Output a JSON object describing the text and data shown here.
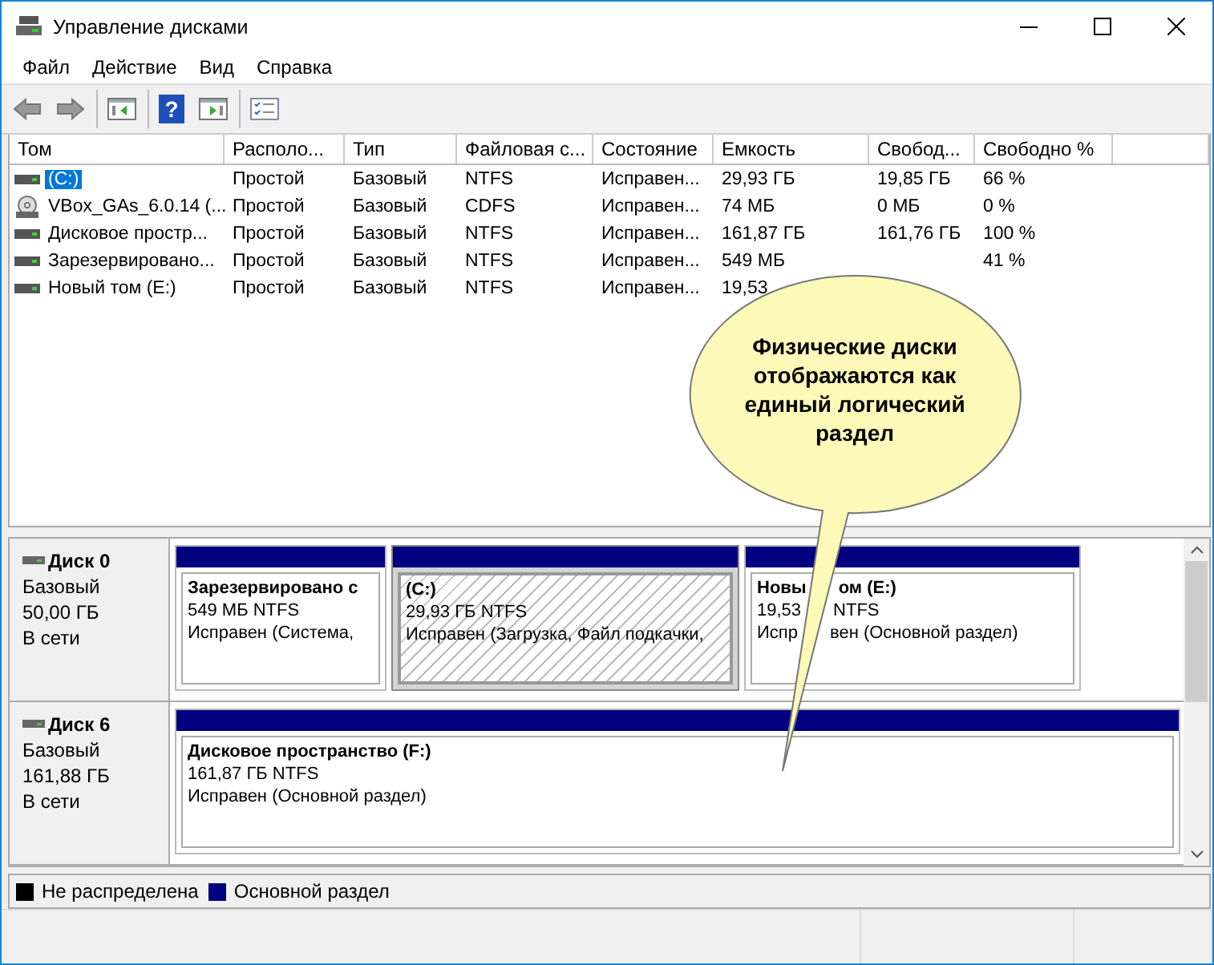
{
  "window": {
    "title": "Управление дисками"
  },
  "menu": [
    "Файл",
    "Действие",
    "Вид",
    "Справка"
  ],
  "toolbar": [
    {
      "kind": "back"
    },
    {
      "kind": "forward"
    },
    {
      "kind": "panel"
    },
    {
      "kind": "help",
      "glyph": "?"
    },
    {
      "kind": "panel-play"
    },
    {
      "kind": "list"
    }
  ],
  "table": {
    "columns": [
      "Том",
      "Располо...",
      "Тип",
      "Файловая с...",
      "Состояние",
      "Емкость",
      "Свобод...",
      "Свободно %"
    ],
    "rows": [
      {
        "kind": "drive",
        "selected": true,
        "cells": [
          "(C:)",
          "Простой",
          "Базовый",
          "NTFS",
          "Исправен...",
          "29,93 ГБ",
          "19,85 ГБ",
          "66 %"
        ]
      },
      {
        "kind": "cd",
        "selected": false,
        "cells": [
          "VBox_GAs_6.0.14 (...",
          "Простой",
          "Базовый",
          "CDFS",
          "Исправен...",
          "74 МБ",
          "0 МБ",
          "0 %"
        ]
      },
      {
        "kind": "drive",
        "selected": false,
        "cells": [
          "Дисковое простр...",
          "Простой",
          "Базовый",
          "NTFS",
          "Исправен...",
          "161,87 ГБ",
          "161,76 ГБ",
          "100 %"
        ]
      },
      {
        "kind": "drive",
        "selected": false,
        "cells": [
          "Зарезервировано...",
          "Простой",
          "Базовый",
          "NTFS",
          "Исправен...",
          "549 МБ",
          null,
          "41 %"
        ]
      },
      {
        "kind": "drive",
        "selected": false,
        "cells": [
          "Новый том (E:)",
          "Простой",
          "Базовый",
          "NTFS",
          "Исправен...",
          "19,53",
          null,
          null
        ]
      }
    ]
  },
  "disks": [
    {
      "name": "Диск 0",
      "type": "Базовый",
      "size": "50,00 ГБ",
      "status": "В сети",
      "partitions": [
        {
          "title": "Зарезервировано с",
          "size": "549 МБ NTFS",
          "status": "Исправен (Система,",
          "selected": false
        },
        {
          "title": "(C:)",
          "size": "29,93 ГБ NTFS",
          "status": "Исправен (Загрузка, Файл подкачки,",
          "selected": true
        },
        {
          "title": [
            "Новы",
            "ом  (E:)"
          ],
          "size": [
            "19,53",
            "NTFS"
          ],
          "status": [
            "Испр",
            "вен (Основной раздел)"
          ],
          "selected": false
        }
      ]
    },
    {
      "name": "Диск 6",
      "type": "Базовый",
      "size": "161,88 ГБ",
      "status": "В сети",
      "partitions": [
        {
          "title": "Дисковое пространство  (F:)",
          "size": "161,87 ГБ NTFS",
          "status": "Исправен (Основной раздел)",
          "selected": false
        }
      ]
    }
  ],
  "legend": [
    {
      "label": "Не распределена",
      "color": "#000000"
    },
    {
      "label": "Основной раздел",
      "color": "#000080"
    }
  ],
  "callout": {
    "text": "Физические диски отображаются как единый логический раздел"
  }
}
